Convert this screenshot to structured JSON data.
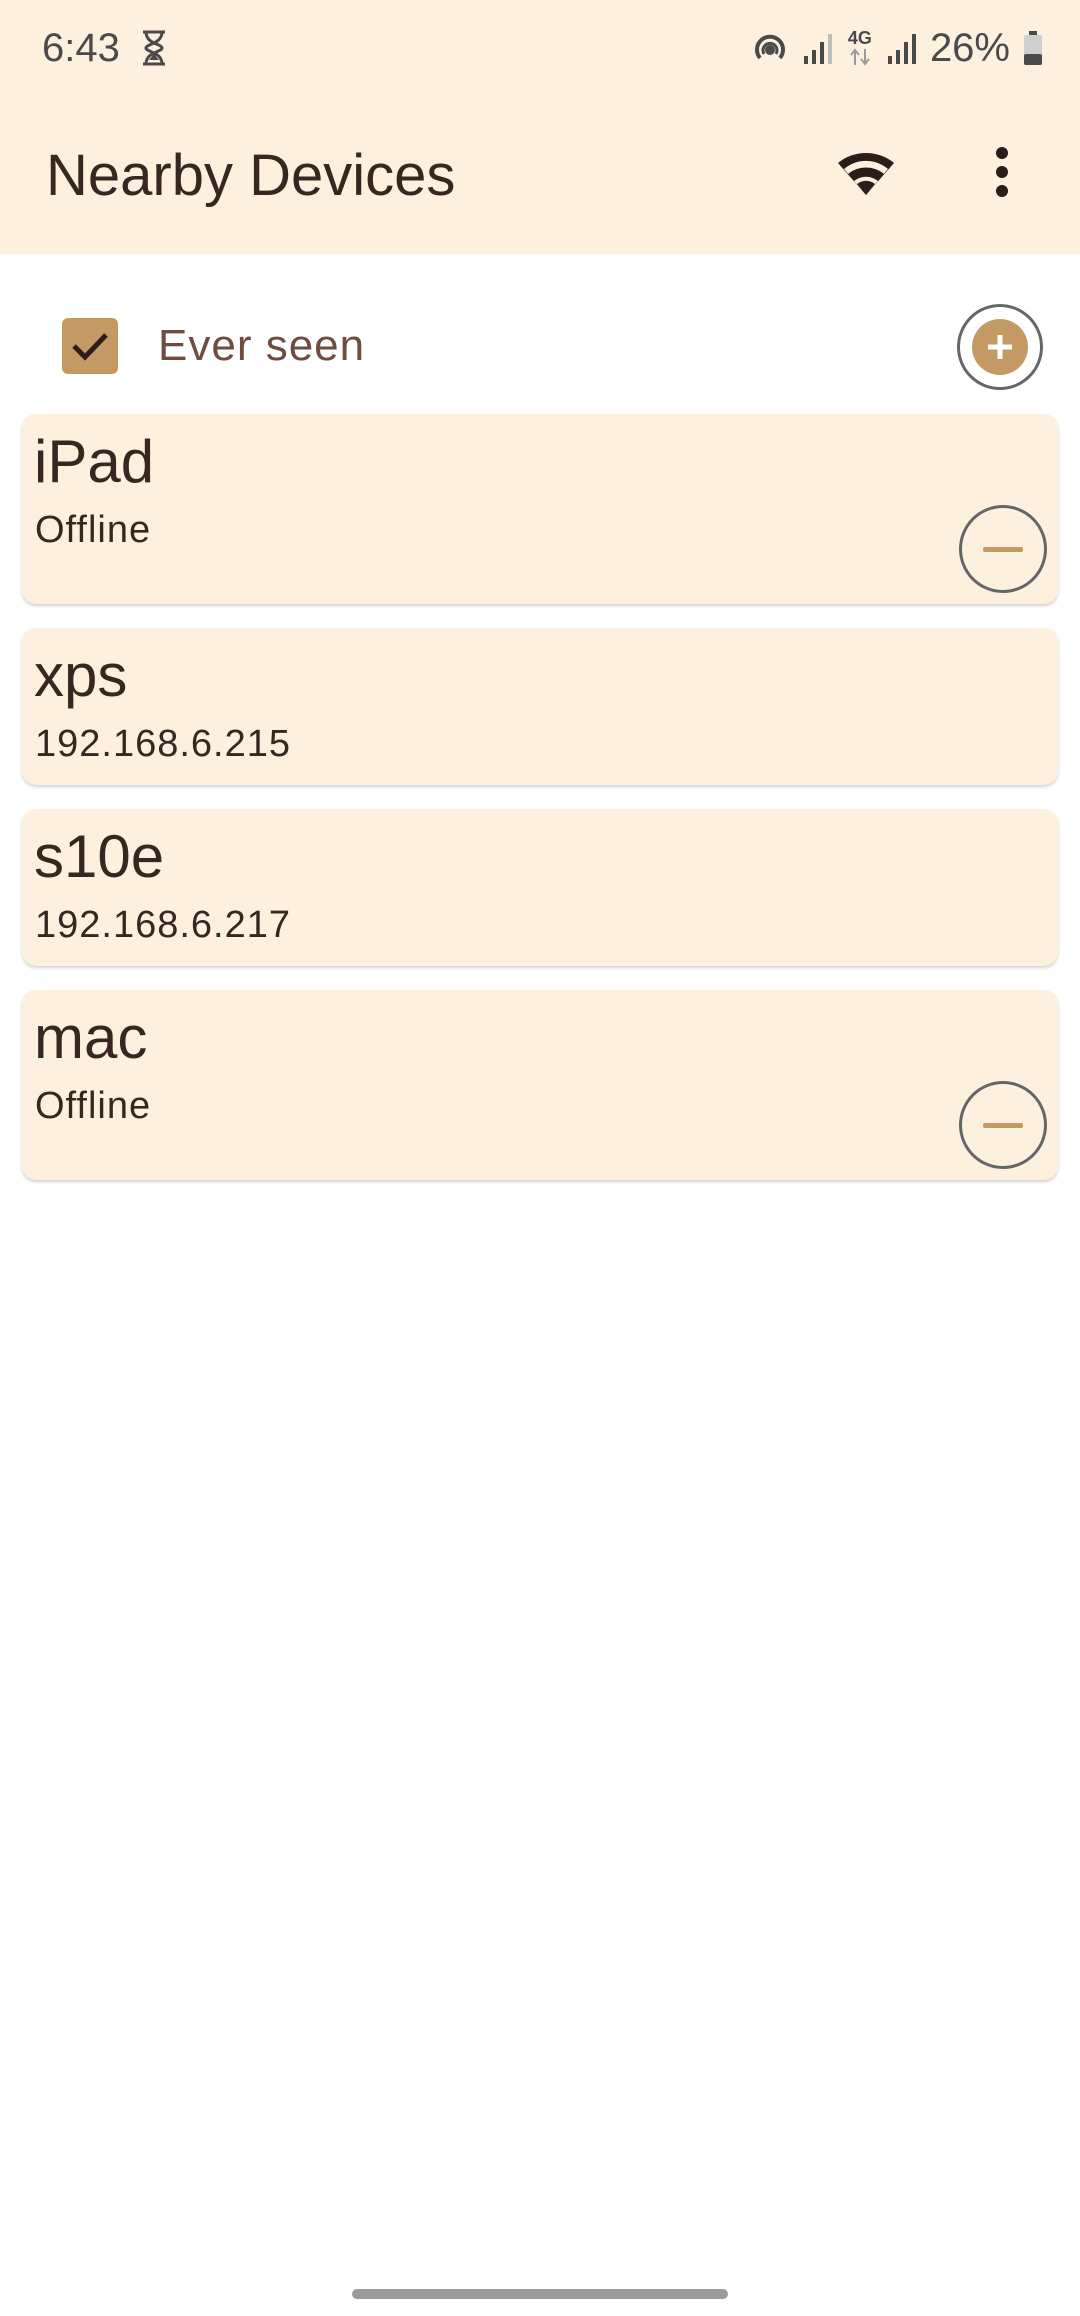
{
  "status_bar": {
    "time": "6:43",
    "battery_percent": "26%",
    "network_type": "4G",
    "icons": [
      "hourglass-icon",
      "hotspot-icon",
      "signal-icon",
      "data-arrows-icon",
      "battery-icon"
    ]
  },
  "app_bar": {
    "title": "Nearby Devices",
    "actions": [
      "wifi-icon",
      "more-vert-icon"
    ]
  },
  "filter": {
    "label": "Ever seen",
    "checked": true
  },
  "devices": [
    {
      "name": "iPad",
      "status": "Offline",
      "removable": true
    },
    {
      "name": "xps",
      "status": "192.168.6.215",
      "removable": false
    },
    {
      "name": "s10e",
      "status": "192.168.6.217",
      "removable": false
    },
    {
      "name": "mac",
      "status": "Offline",
      "removable": true
    }
  ],
  "colors": {
    "surface": "#fdf0df",
    "accent": "#c39a64",
    "text": "#3a2620",
    "label_muted": "#6e4c3f"
  }
}
